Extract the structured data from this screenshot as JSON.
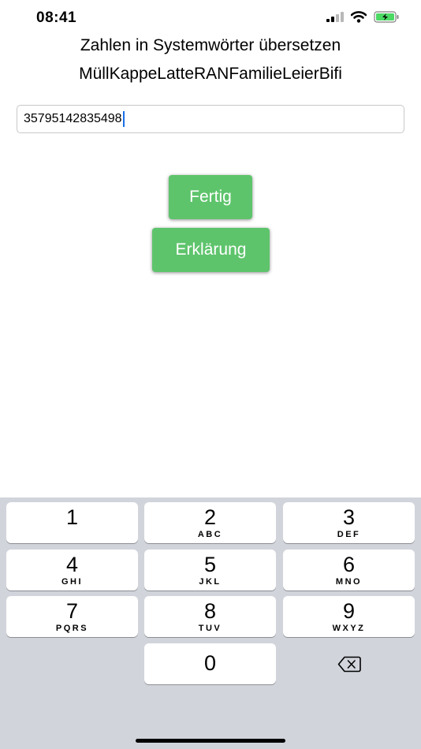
{
  "status_bar": {
    "time": "08:41"
  },
  "title_line_1": "Zahlen in Systemwörter übersetzen",
  "title_line_2": "MüllKappeLatteRANFamilieLeierBifi",
  "number_input": {
    "value": "35795142835498"
  },
  "buttons": {
    "done": "Fertig",
    "explanation": "Erklärung"
  },
  "colors": {
    "button_green": "#5ec46c",
    "keyboard_bg": "#d1d4db",
    "caret": "#1a6fe8"
  },
  "keypad": {
    "keys": [
      {
        "digit": "1",
        "letters": ""
      },
      {
        "digit": "2",
        "letters": "ABC"
      },
      {
        "digit": "3",
        "letters": "DEF"
      },
      {
        "digit": "4",
        "letters": "GHI"
      },
      {
        "digit": "5",
        "letters": "JKL"
      },
      {
        "digit": "6",
        "letters": "MNO"
      },
      {
        "digit": "7",
        "letters": "PQRS"
      },
      {
        "digit": "8",
        "letters": "TUV"
      },
      {
        "digit": "9",
        "letters": "WXYZ"
      }
    ],
    "zero": "0",
    "backspace_icon": "backspace-icon"
  }
}
